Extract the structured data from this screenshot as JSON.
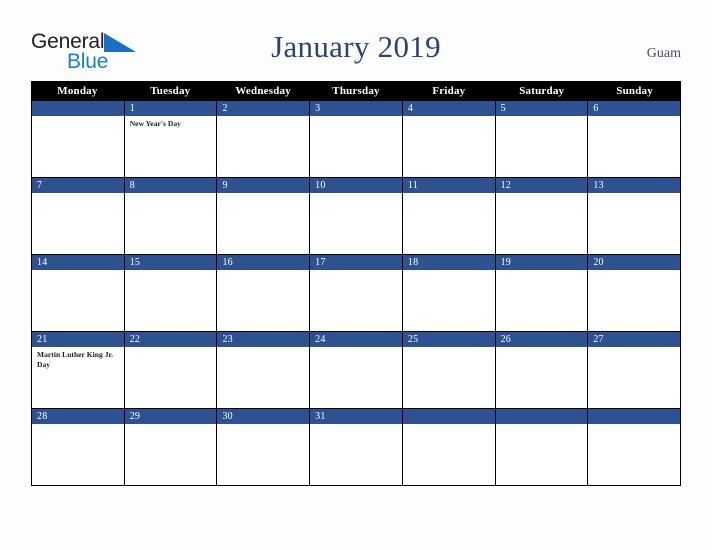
{
  "brand": {
    "name_part_1": "General",
    "name_part_2": "Blue",
    "triangle_icon": "triangle-icon",
    "color_dark": "#231f20",
    "color_blue": "#1a7fd4"
  },
  "header": {
    "title": "January 2019",
    "location": "Guam",
    "title_color": "#2e4372",
    "location_color": "#3c4f7d"
  },
  "calendar": {
    "month": "January",
    "year": "2019",
    "accent_color": "#2d5191",
    "header_bg": "#000000",
    "weekday_headers": [
      "Monday",
      "Tuesday",
      "Wednesday",
      "Thursday",
      "Friday",
      "Saturday",
      "Sunday"
    ],
    "weeks": [
      [
        {
          "day": "",
          "event": ""
        },
        {
          "day": "1",
          "event": "New Year's Day"
        },
        {
          "day": "2",
          "event": ""
        },
        {
          "day": "3",
          "event": ""
        },
        {
          "day": "4",
          "event": ""
        },
        {
          "day": "5",
          "event": ""
        },
        {
          "day": "6",
          "event": ""
        }
      ],
      [
        {
          "day": "7",
          "event": ""
        },
        {
          "day": "8",
          "event": ""
        },
        {
          "day": "9",
          "event": ""
        },
        {
          "day": "10",
          "event": ""
        },
        {
          "day": "11",
          "event": ""
        },
        {
          "day": "12",
          "event": ""
        },
        {
          "day": "13",
          "event": ""
        }
      ],
      [
        {
          "day": "14",
          "event": ""
        },
        {
          "day": "15",
          "event": ""
        },
        {
          "day": "16",
          "event": ""
        },
        {
          "day": "17",
          "event": ""
        },
        {
          "day": "18",
          "event": ""
        },
        {
          "day": "19",
          "event": ""
        },
        {
          "day": "20",
          "event": ""
        }
      ],
      [
        {
          "day": "21",
          "event": "Martin Luther King Jr. Day"
        },
        {
          "day": "22",
          "event": ""
        },
        {
          "day": "23",
          "event": ""
        },
        {
          "day": "24",
          "event": ""
        },
        {
          "day": "25",
          "event": ""
        },
        {
          "day": "26",
          "event": ""
        },
        {
          "day": "27",
          "event": ""
        }
      ],
      [
        {
          "day": "28",
          "event": ""
        },
        {
          "day": "29",
          "event": ""
        },
        {
          "day": "30",
          "event": ""
        },
        {
          "day": "31",
          "event": ""
        },
        {
          "day": "",
          "event": ""
        },
        {
          "day": "",
          "event": ""
        },
        {
          "day": "",
          "event": ""
        }
      ]
    ]
  }
}
